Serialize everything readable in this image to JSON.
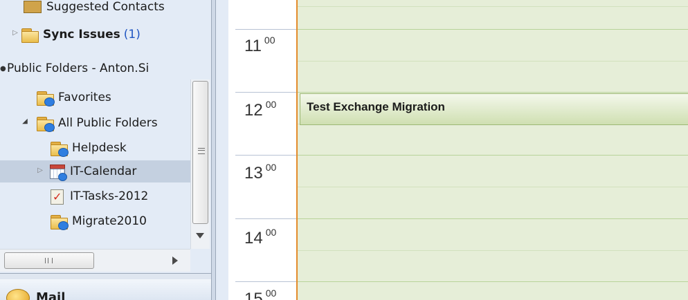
{
  "folder_pane": {
    "mail_folders": [
      {
        "label": "Suggested Contacts",
        "count": ""
      },
      {
        "label": "Sync Issues",
        "count": "(1)"
      }
    ],
    "public_folders_header": "Public Folders - Anton.Si",
    "public_folders": [
      {
        "label": "Favorites"
      },
      {
        "label": "All Public Folders"
      },
      {
        "label": "Helpdesk"
      },
      {
        "label": "IT-Calendar"
      },
      {
        "label": "IT-Tasks-2012"
      },
      {
        "label": "Migrate2010"
      }
    ],
    "nav_buttons": [
      {
        "label": "Mail"
      }
    ]
  },
  "calendar": {
    "hours": [
      {
        "hour": "11",
        "minutes": "00"
      },
      {
        "hour": "12",
        "minutes": "00"
      },
      {
        "hour": "13",
        "minutes": "00"
      },
      {
        "hour": "14",
        "minutes": "00"
      },
      {
        "hour": "15",
        "minutes": "00"
      }
    ],
    "appointment": {
      "title": "Test Exchange Migration"
    }
  },
  "colors": {
    "folder_pane_bg": "#e3ebf6",
    "selected_row": "#c4d0e0",
    "day_area_bg": "#e6eed8",
    "now_marker": "#e38b2b",
    "appointment_border": "#9cb874",
    "unread_count": "#1f55c2"
  }
}
